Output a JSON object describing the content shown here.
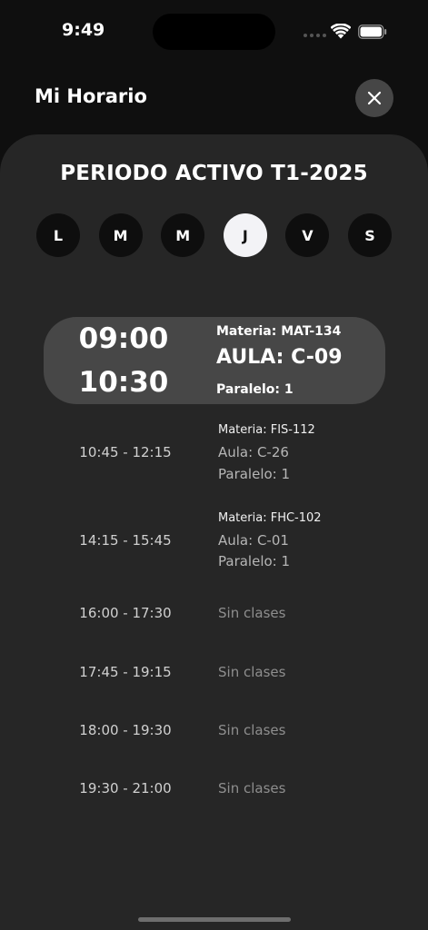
{
  "status_bar": {
    "time": "9:49"
  },
  "header": {
    "title": "Mi Horario"
  },
  "period": {
    "title": "PERIODO ACTIVO T1-2025"
  },
  "days": [
    {
      "label": "L",
      "active": false
    },
    {
      "label": "M",
      "active": false
    },
    {
      "label": "M",
      "active": false
    },
    {
      "label": "J",
      "active": true
    },
    {
      "label": "V",
      "active": false
    },
    {
      "label": "S",
      "active": false
    }
  ],
  "current_class": {
    "start": "09:00",
    "end": "10:30",
    "materia": "Materia: MAT-134",
    "aula": "AULA: C-09",
    "paralelo": "Paralelo: 1"
  },
  "schedule": [
    {
      "time": "10:45 - 12:15",
      "materia": "Materia: FIS-112",
      "aula": "Aula: C-26",
      "paralelo": "Paralelo: 1"
    },
    {
      "time": "14:15 - 15:45",
      "materia": "Materia: FHC-102",
      "aula": "Aula: C-01",
      "paralelo": "Paralelo: 1"
    },
    {
      "time": "16:00 - 17:30",
      "status": "Sin clases"
    },
    {
      "time": "17:45 - 19:15",
      "status": "Sin clases"
    },
    {
      "time": "18:00 - 19:30",
      "status": "Sin clases"
    },
    {
      "time": "19:30 - 21:00",
      "status": "Sin clases"
    }
  ],
  "colors": {
    "background": "#0f0f0f",
    "sheet": "#262626",
    "active_card": "#474747",
    "day_active": "#f3f3f6",
    "day_inactive": "#0e0e0e"
  }
}
